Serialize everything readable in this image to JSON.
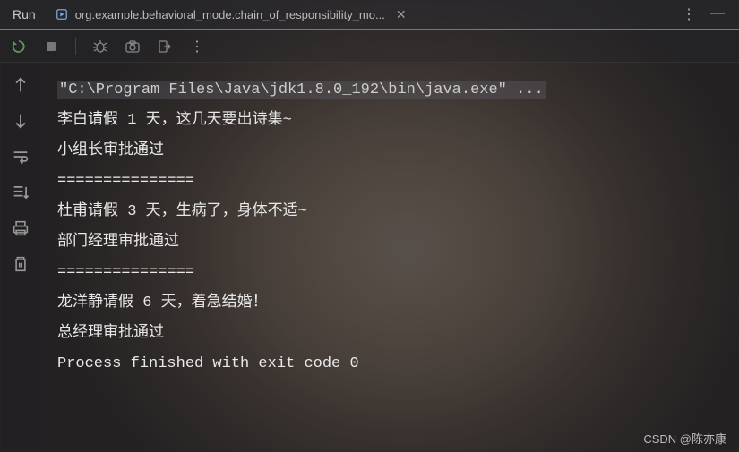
{
  "header": {
    "run_label": "Run",
    "tab": {
      "title": "org.example.behavioral_mode.chain_of_responsibility_mo...",
      "close": "✕"
    },
    "overflow": "⋮",
    "hide": "—"
  },
  "toolbar": {
    "rerun": "rerun",
    "stop": "stop",
    "debug": "debug",
    "snapshot": "snapshot",
    "exit": "exit",
    "more": "⋮"
  },
  "rail": {
    "up": "↑",
    "down": "↓",
    "wrap": "wrap",
    "scroll": "scroll",
    "print": "print",
    "delete": "delete"
  },
  "console": {
    "cmd": "\"C:\\Program Files\\Java\\jdk1.8.0_192\\bin\\java.exe\" ...",
    "lines": [
      "李白请假 1 天，这几天要出诗集~",
      "小组长审批通过",
      "===============",
      "杜甫请假 3 天，生病了，身体不适~",
      "部门经理审批通过",
      "===============",
      "龙洋静请假 6 天，着急结婚！",
      "总经理审批通过",
      "",
      "Process finished with exit code 0"
    ]
  },
  "watermark": "CSDN @陈亦康"
}
